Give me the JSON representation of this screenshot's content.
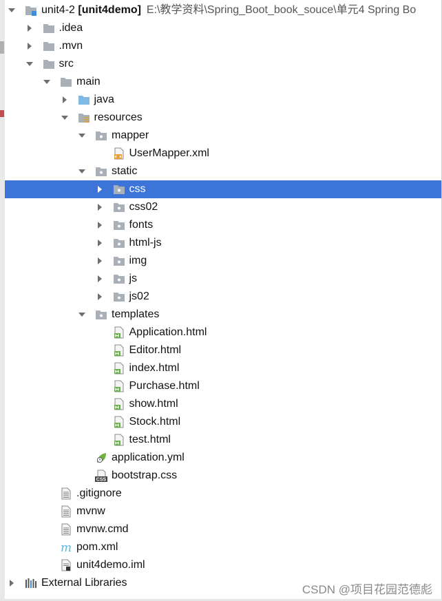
{
  "project": {
    "name": "unit4-2",
    "module": "[unit4demo]",
    "path": "E:\\教学资料\\Spring_Boot_book_souce\\单元4 Spring Bo"
  },
  "nodes": [
    {
      "label": "unit4-2",
      "bold": "[unit4demo]",
      "path": "E:\\教学资料\\Spring_Boot_book_souce\\单元4 Spring Bo",
      "level": 0,
      "arrow": "down",
      "icon": "module-folder-icon",
      "name": "project-root"
    },
    {
      "label": ".idea",
      "level": 1,
      "arrow": "right",
      "icon": "folder-icon",
      "name": "folder-idea"
    },
    {
      "label": ".mvn",
      "level": 1,
      "arrow": "right",
      "icon": "folder-icon",
      "name": "folder-mvn"
    },
    {
      "label": "src",
      "level": 1,
      "arrow": "down",
      "icon": "folder-icon",
      "name": "folder-src"
    },
    {
      "label": "main",
      "level": 2,
      "arrow": "down",
      "icon": "folder-icon",
      "name": "folder-main"
    },
    {
      "label": "java",
      "level": 3,
      "arrow": "right",
      "icon": "source-folder-icon",
      "name": "folder-java"
    },
    {
      "label": "resources",
      "level": 3,
      "arrow": "down",
      "icon": "resources-folder-icon",
      "name": "folder-resources"
    },
    {
      "label": "mapper",
      "level": 4,
      "arrow": "down",
      "icon": "package-folder-icon",
      "name": "folder-mapper"
    },
    {
      "label": "UserMapper.xml",
      "level": 5,
      "arrow": "",
      "icon": "xml-file-icon",
      "name": "file-usermapper-xml"
    },
    {
      "label": "static",
      "level": 4,
      "arrow": "down",
      "icon": "package-folder-icon",
      "name": "folder-static"
    },
    {
      "label": "css",
      "level": 5,
      "arrow": "right",
      "icon": "package-folder-icon",
      "name": "folder-css",
      "selected": true
    },
    {
      "label": "css02",
      "level": 5,
      "arrow": "right",
      "icon": "package-folder-icon",
      "name": "folder-css02"
    },
    {
      "label": "fonts",
      "level": 5,
      "arrow": "right",
      "icon": "package-folder-icon",
      "name": "folder-fonts"
    },
    {
      "label": "html-js",
      "level": 5,
      "arrow": "right",
      "icon": "package-folder-icon",
      "name": "folder-html-js"
    },
    {
      "label": "img",
      "level": 5,
      "arrow": "right",
      "icon": "package-folder-icon",
      "name": "folder-img"
    },
    {
      "label": "js",
      "level": 5,
      "arrow": "right",
      "icon": "package-folder-icon",
      "name": "folder-js"
    },
    {
      "label": "js02",
      "level": 5,
      "arrow": "right",
      "icon": "package-folder-icon",
      "name": "folder-js02"
    },
    {
      "label": "templates",
      "level": 4,
      "arrow": "down",
      "icon": "package-folder-icon",
      "name": "folder-templates"
    },
    {
      "label": "Application.html",
      "level": 5,
      "arrow": "",
      "icon": "html-file-icon",
      "name": "file-application-html"
    },
    {
      "label": "Editor.html",
      "level": 5,
      "arrow": "",
      "icon": "html-file-icon",
      "name": "file-editor-html"
    },
    {
      "label": "index.html",
      "level": 5,
      "arrow": "",
      "icon": "html-file-icon",
      "name": "file-index-html"
    },
    {
      "label": "Purchase.html",
      "level": 5,
      "arrow": "",
      "icon": "html-file-icon",
      "name": "file-purchase-html"
    },
    {
      "label": "show.html",
      "level": 5,
      "arrow": "",
      "icon": "html-file-icon",
      "name": "file-show-html"
    },
    {
      "label": "Stock.html",
      "level": 5,
      "arrow": "",
      "icon": "html-file-icon",
      "name": "file-stock-html"
    },
    {
      "label": "test.html",
      "level": 5,
      "arrow": "",
      "icon": "html-file-icon",
      "name": "file-test-html"
    },
    {
      "label": "application.yml",
      "level": 4,
      "arrow": "",
      "icon": "spring-yml-icon",
      "name": "file-application-yml"
    },
    {
      "label": "bootstrap.css",
      "level": 4,
      "arrow": "",
      "icon": "css-file-icon",
      "name": "file-bootstrap-css"
    },
    {
      "label": ".gitignore",
      "level": 2,
      "arrow": "",
      "icon": "text-file-icon",
      "name": "file-gitignore"
    },
    {
      "label": "mvnw",
      "level": 2,
      "arrow": "",
      "icon": "text-file-icon",
      "name": "file-mvnw"
    },
    {
      "label": "mvnw.cmd",
      "level": 2,
      "arrow": "",
      "icon": "text-file-icon",
      "name": "file-mvnw-cmd"
    },
    {
      "label": "pom.xml",
      "level": 2,
      "arrow": "",
      "icon": "maven-icon",
      "name": "file-pom-xml"
    },
    {
      "label": "unit4demo.iml",
      "level": 2,
      "arrow": "",
      "icon": "iml-file-icon",
      "name": "file-unit4demo-iml"
    },
    {
      "label": "External Libraries",
      "level": 0,
      "arrow": "right",
      "icon": "libraries-icon",
      "name": "external-libraries"
    }
  ],
  "watermark": "CSDN @项目花园范德彪",
  "colors": {
    "selection": "#3d74d8",
    "folder": "#a9b0b8",
    "source_folder": "#7fb9e6",
    "html_icon": "#6bab4f",
    "xml_icon": "#e8a03c"
  }
}
